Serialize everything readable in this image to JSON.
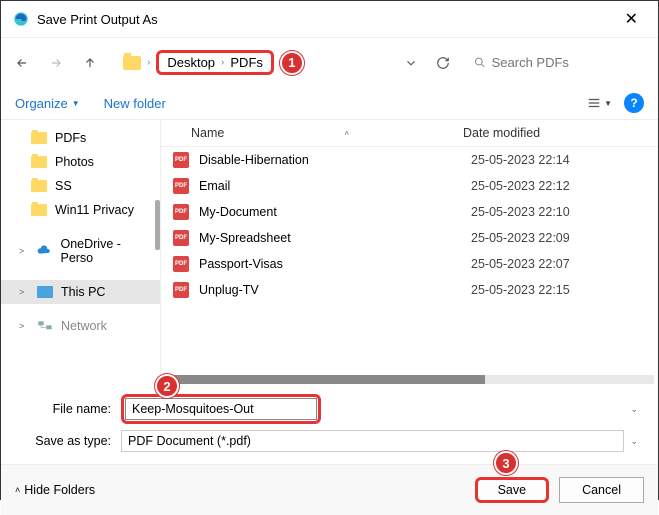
{
  "window": {
    "title": "Save Print Output As"
  },
  "breadcrumb": {
    "parts": [
      "Desktop",
      "PDFs"
    ]
  },
  "search": {
    "placeholder": "Search PDFs"
  },
  "toolbar": {
    "organize": "Organize",
    "new_folder": "New folder"
  },
  "sidebar": {
    "items": [
      {
        "label": "PDFs",
        "icon": "folder"
      },
      {
        "label": "Photos",
        "icon": "folder"
      },
      {
        "label": "SS",
        "icon": "folder"
      },
      {
        "label": "Win11 Privacy",
        "icon": "folder"
      },
      {
        "label": "OneDrive - Perso",
        "icon": "cloud",
        "chev": ">"
      },
      {
        "label": "This PC",
        "icon": "pc",
        "chev": ">",
        "selected": true
      },
      {
        "label": "Network",
        "icon": "net",
        "chev": ">"
      }
    ]
  },
  "columns": {
    "name": "Name",
    "date": "Date modified"
  },
  "files": [
    {
      "name": "Disable-Hibernation",
      "date": "25-05-2023 22:14"
    },
    {
      "name": "Email",
      "date": "25-05-2023 22:12"
    },
    {
      "name": "My-Document",
      "date": "25-05-2023 22:10"
    },
    {
      "name": "My-Spreadsheet",
      "date": "25-05-2023 22:09"
    },
    {
      "name": "Passport-Visas",
      "date": "25-05-2023 22:07"
    },
    {
      "name": "Unplug-TV",
      "date": "25-05-2023 22:15"
    }
  ],
  "inputs": {
    "file_name_label": "File name:",
    "file_name_value": "Keep-Mosquitoes-Out",
    "save_type_label": "Save as type:",
    "save_type_value": "PDF Document (*.pdf)"
  },
  "footer": {
    "hide_folders": "Hide Folders",
    "save": "Save",
    "cancel": "Cancel"
  },
  "annotations": {
    "a1": "1",
    "a2": "2",
    "a3": "3"
  }
}
